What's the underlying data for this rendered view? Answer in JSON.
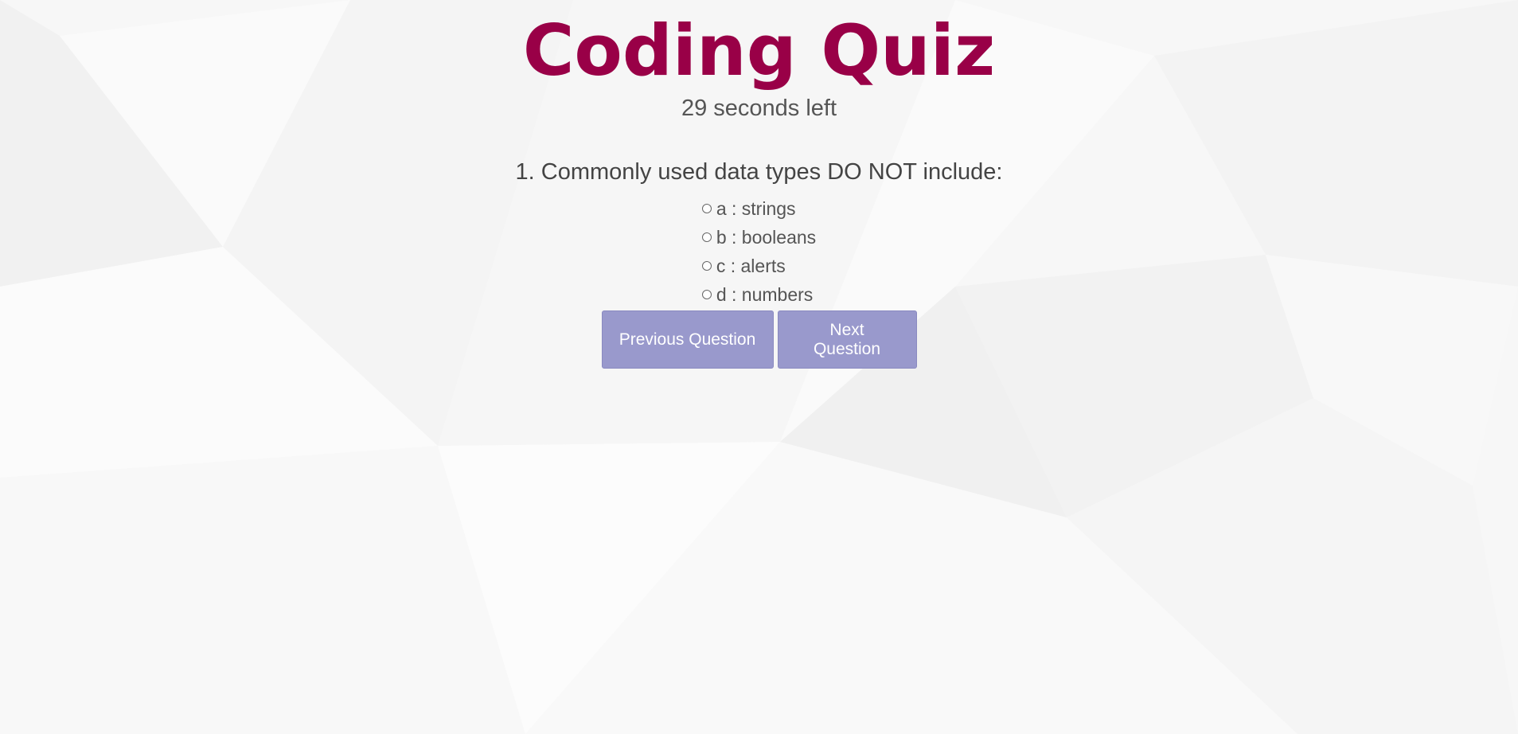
{
  "header": {
    "title": "Coding Quiz",
    "timer_text": "29 seconds left"
  },
  "quiz": {
    "question": "1. Commonly used data types DO NOT include:",
    "answers": [
      {
        "label": "a : strings"
      },
      {
        "label": "b : booleans"
      },
      {
        "label": "c : alerts"
      },
      {
        "label": "d : numbers"
      }
    ]
  },
  "buttons": {
    "previous_label": "Previous Question",
    "next_label": "Next Question"
  },
  "colors": {
    "title": "#990047",
    "button_bg": "#9999cc",
    "background": "#f7f7f7"
  }
}
